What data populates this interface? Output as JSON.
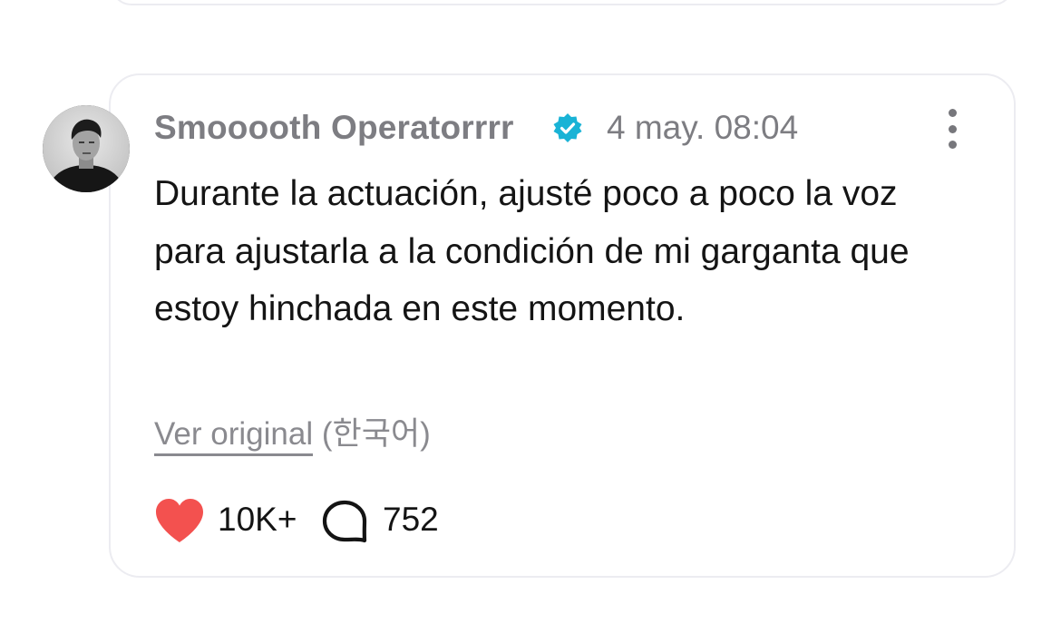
{
  "post": {
    "author": "Smooooth Operatorrrr",
    "verified": true,
    "date": "4 may. 08:04",
    "text": "Durante la actuación, ajusté poco a poco la voz para ajustarla a la condición de mi garganta que estoy hinchada en este momento.",
    "view_original_label": "Ver original",
    "original_language": "(한국어)",
    "likes": "10K+",
    "comments": "752"
  },
  "icons": {
    "verified": "verified-badge-icon",
    "more": "more-vertical-icon",
    "like": "heart-icon",
    "comment": "comment-bubble-icon"
  },
  "colors": {
    "verified_badge": "#19b3d6",
    "heart": "#f3514f",
    "muted_text": "#7d7d82",
    "body_text": "#141414",
    "card_border": "#ececf1"
  }
}
